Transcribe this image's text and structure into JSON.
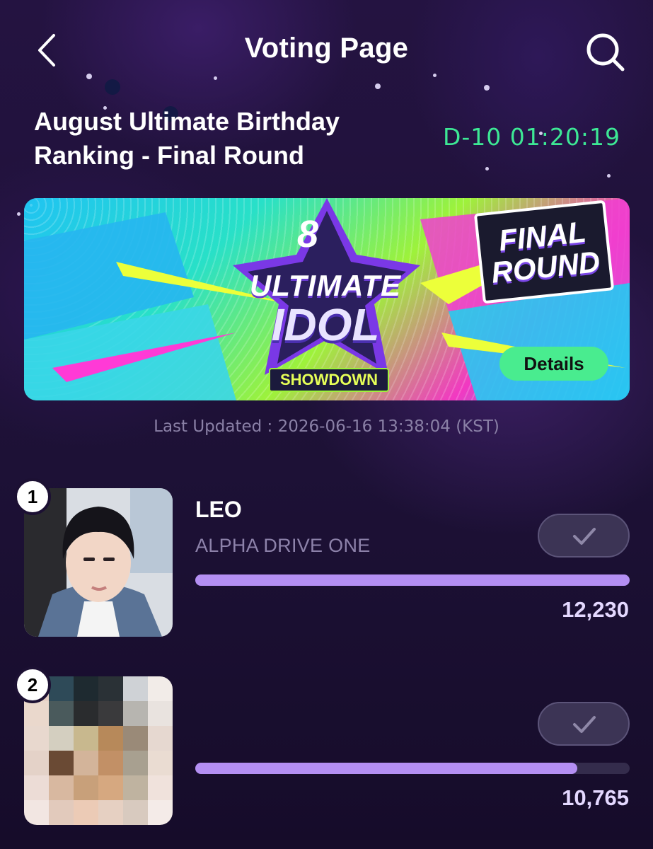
{
  "header": {
    "title": "Voting Page"
  },
  "event": {
    "title_line1": "August Ultimate Birthday",
    "title_line2": "Ranking - Final Round",
    "countdown": "D-10 01:20:19"
  },
  "banner": {
    "logo_number": "8",
    "logo_ultimate": "ULTIMATE",
    "logo_idol": "IDOL",
    "logo_showdown": "SHOWDOWN",
    "final_line1": "FINAL",
    "final_line2": "ROUND",
    "details_label": "Details"
  },
  "last_updated": "Last Updated : 2026-06-16 13:38:04 (KST)",
  "ranking": [
    {
      "rank": "1",
      "name": "LEO",
      "group": "ALPHA DRIVE ONE",
      "votes": "12,230",
      "progress": 1.0
    },
    {
      "rank": "2",
      "name": "",
      "group": "",
      "votes": "10,765",
      "progress": 0.88
    }
  ],
  "colors": {
    "accent_green": "#3de895",
    "progress": "#b48ff3",
    "details_button": "#49ec8f"
  },
  "icons": {
    "back": "chevron-left-icon",
    "search": "search-icon",
    "vote": "check-icon"
  }
}
